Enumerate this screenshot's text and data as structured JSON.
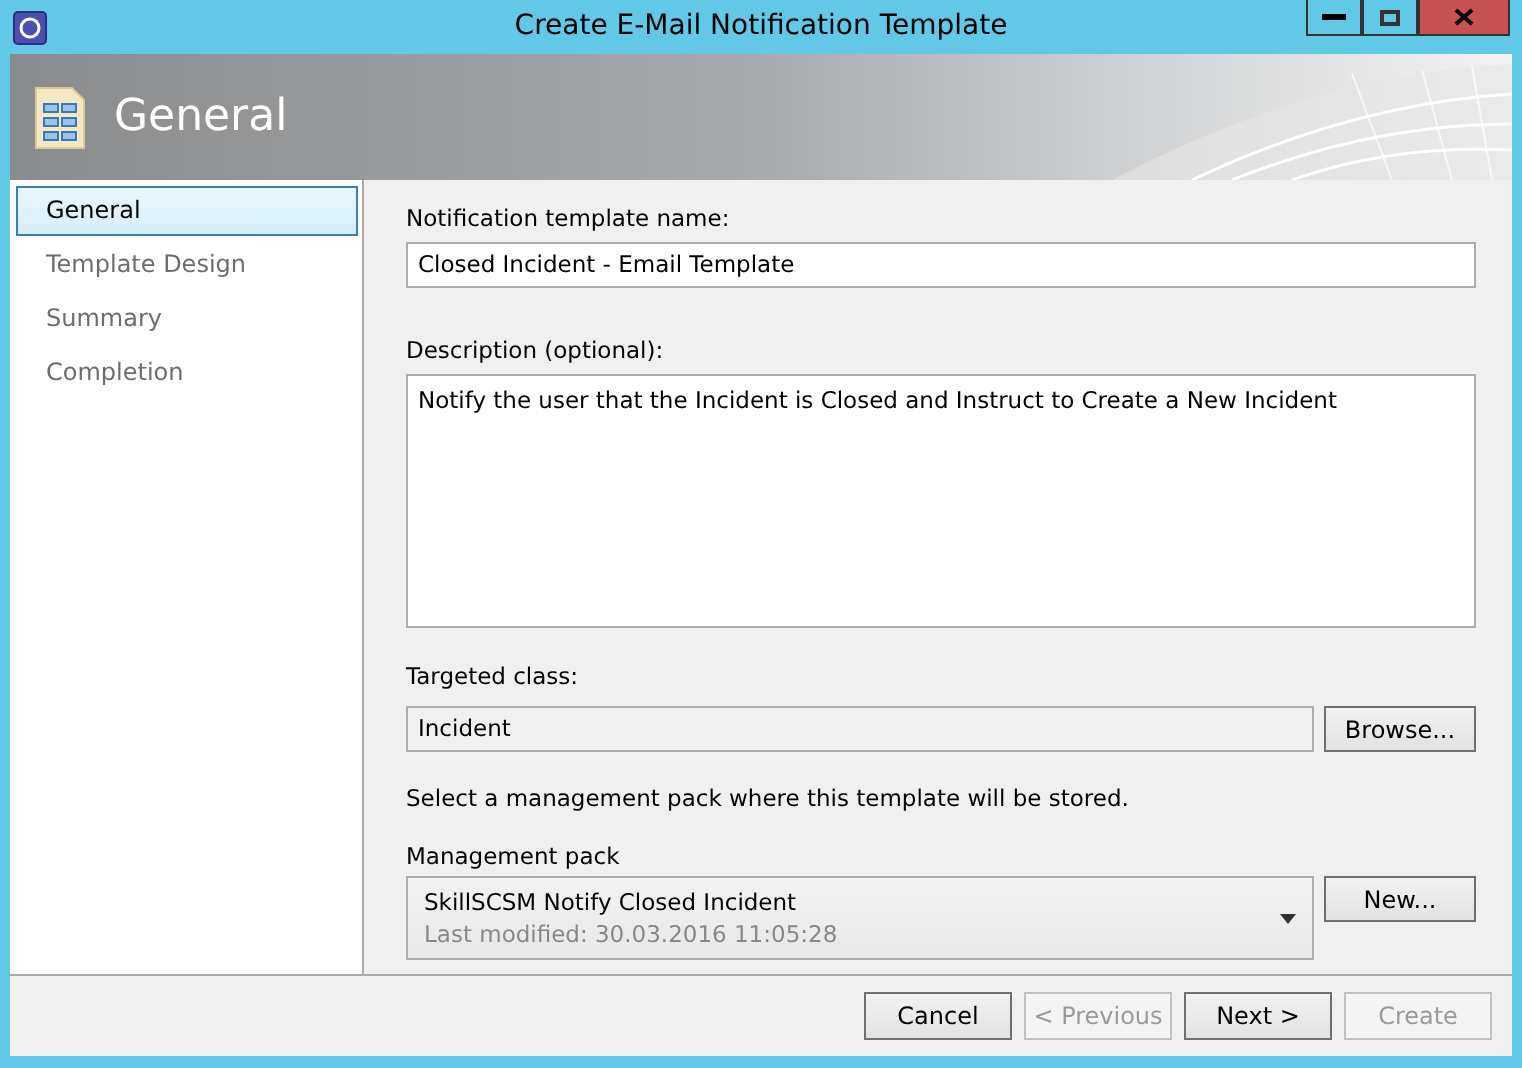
{
  "window": {
    "title": "Create E-Mail Notification Template"
  },
  "header": {
    "title": "General"
  },
  "steps": [
    {
      "label": "General",
      "selected": true
    },
    {
      "label": "Template Design",
      "selected": false
    },
    {
      "label": "Summary",
      "selected": false
    },
    {
      "label": "Completion",
      "selected": false
    }
  ],
  "form": {
    "name_label": "Notification template name:",
    "name_value": "Closed Incident - Email Template",
    "description_label": "Description (optional):",
    "description_value": "Notify the user that the Incident is Closed and Instruct to Create a New Incident",
    "class_label": "Targeted class:",
    "class_value": "Incident",
    "browse_button": "Browse...",
    "pack_hint": "Select a management pack where this template will be stored.",
    "pack_label": "Management pack",
    "pack_name": "SkillSCSM Notify Closed Incident",
    "pack_modified": "Last modified:  30.03.2016 11:05:28",
    "new_button": "New..."
  },
  "buttons": [
    {
      "label": "Cancel",
      "disabled": false
    },
    {
      "label": "< Previous",
      "disabled": true
    },
    {
      "label": "Next >",
      "disabled": false
    },
    {
      "label": "Create",
      "disabled": true
    }
  ]
}
